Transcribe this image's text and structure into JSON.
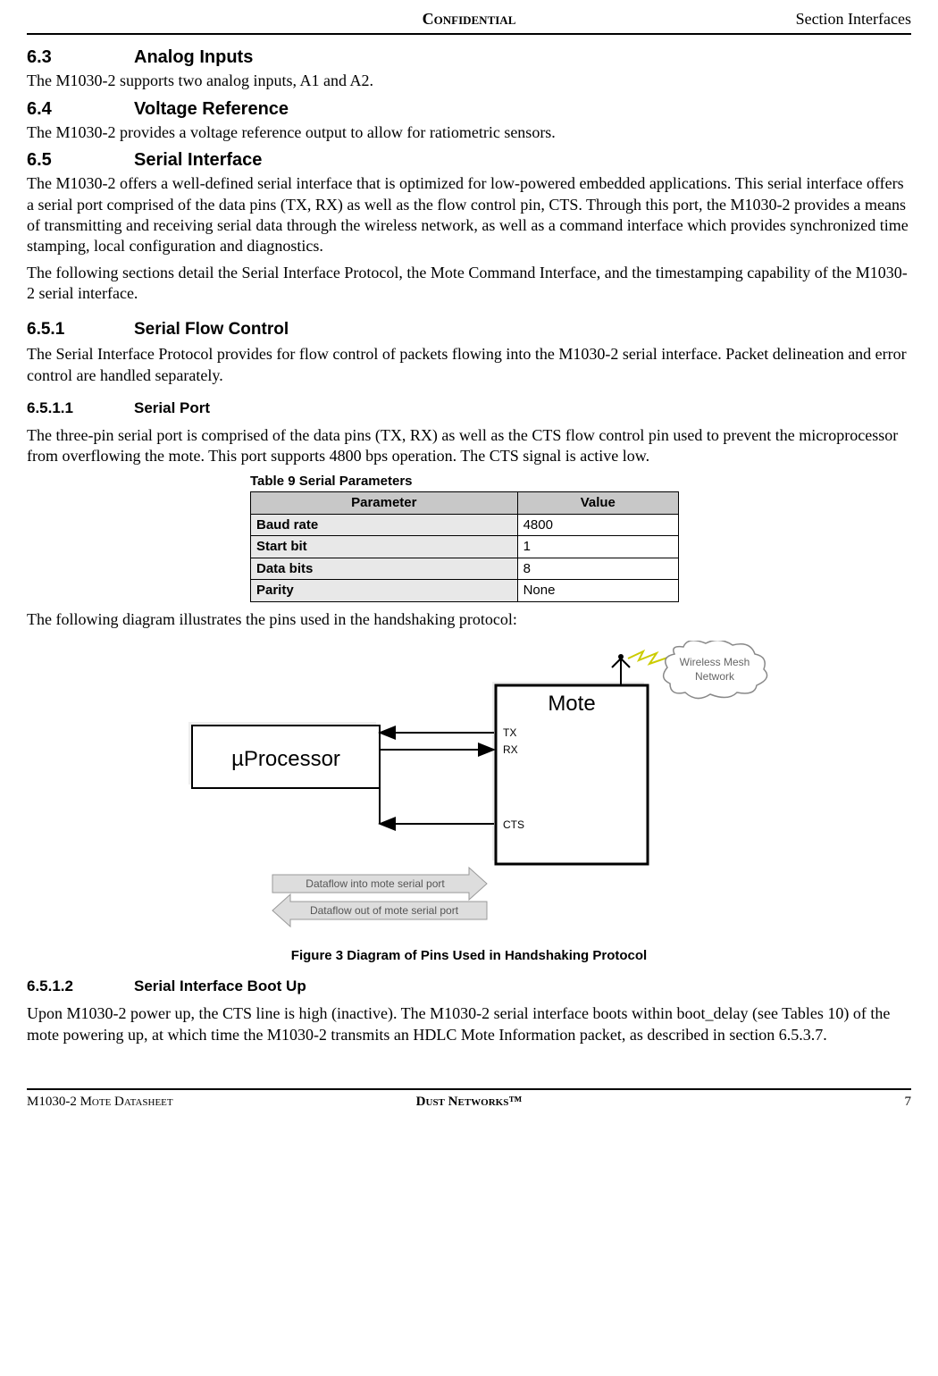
{
  "header": {
    "center": "Confidential",
    "right": "Section Interfaces"
  },
  "s63": {
    "num": "6.3",
    "title": "Analog Inputs",
    "p1": "The M1030-2 supports two analog inputs, A1 and A2."
  },
  "s64": {
    "num": "6.4",
    "title": "Voltage Reference",
    "p1": "The M1030-2 provides a voltage reference output to allow for ratiometric sensors."
  },
  "s65": {
    "num": "6.5",
    "title": "Serial Interface",
    "p1": "The M1030-2 offers a well-defined serial interface that is optimized for low-powered embedded applications. This serial interface offers a serial port comprised of the data pins (TX, RX) as well as the flow control pin, CTS. Through this port, the M1030-2 provides a means of transmitting and receiving serial data through the wireless network, as well as a command interface which provides synchronized time stamping, local configuration and diagnostics.",
    "p2": "The following sections detail the Serial Interface Protocol, the Mote Command Interface, and the timestamping capability of the M1030-2 serial interface."
  },
  "s651": {
    "num": "6.5.1",
    "title": "Serial Flow Control",
    "p1": "The Serial Interface Protocol provides for flow control of packets flowing into the M1030-2 serial interface. Packet delineation and error control are handled separately."
  },
  "s6511": {
    "num": "6.5.1.1",
    "title": "Serial Port",
    "p1": "The three-pin serial port is comprised of the data pins (TX, RX) as well as the CTS flow control pin used to prevent the microprocessor from overflowing the mote. This port supports 4800 bps operation. The CTS signal is active low.",
    "p2": "The following diagram illustrates the pins used in the handshaking protocol:"
  },
  "table9": {
    "caption": "Table 9    Serial Parameters",
    "headers": {
      "param": "Parameter",
      "value": "Value"
    },
    "rows": [
      {
        "param": "Baud rate",
        "value": "4800"
      },
      {
        "param": "Start bit",
        "value": "1"
      },
      {
        "param": "Data bits",
        "value": "8"
      },
      {
        "param": "Parity",
        "value": "None"
      }
    ]
  },
  "diagram": {
    "uprocessor": "µProcessor",
    "mote": "Mote",
    "tx": "TX",
    "rx": "RX",
    "cts": "CTS",
    "wireless": "Wireless Mesh Network",
    "dataflow_in": "Dataflow into mote serial port",
    "dataflow_out": "Dataflow out of mote serial port"
  },
  "figure3": {
    "caption": "Figure 3    Diagram of Pins Used in Handshaking Protocol"
  },
  "s6512": {
    "num": "6.5.1.2",
    "title": "Serial Interface Boot Up",
    "p1": "Upon M1030-2 power up, the CTS line is high (inactive). The M1030-2 serial interface boots within boot_delay (see Tables 10) of the mote powering up, at which time the M1030-2 transmits an HDLC Mote Information packet, as described in section 6.5.3.7."
  },
  "footer": {
    "left": "M1030-2 Mote Datasheet",
    "center": "Dust Networks™",
    "right": "7"
  }
}
